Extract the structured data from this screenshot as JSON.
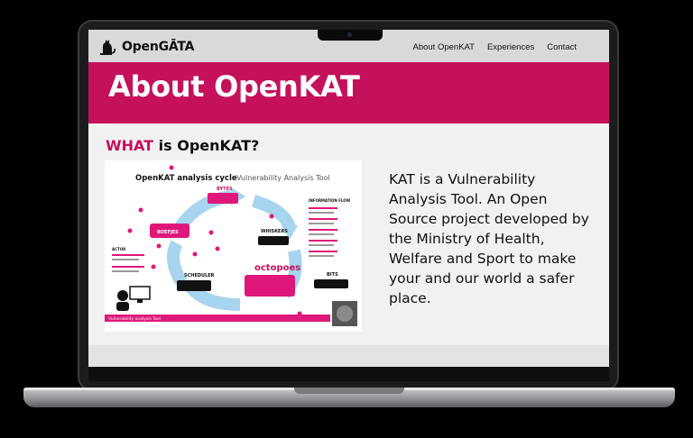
{
  "brand": {
    "name": "OpenGĀTA"
  },
  "nav": {
    "items": [
      "About OpenKAT",
      "Experiences",
      "Contact"
    ]
  },
  "hero": {
    "title": "About OpenKAT"
  },
  "section": {
    "title_accent": "WHAT",
    "title_rest": " is OpenKAT?"
  },
  "diagram": {
    "title_bold": "OpenKAT analysis cycle",
    "title_light": "Vulnerability Analysis Tool",
    "nodes": {
      "bytes": "BYTES",
      "boefjes": "BOEFJES",
      "whiskers": "WHISKERS",
      "octopoes": "octopoes",
      "scheduler": "SCHEDULER",
      "bits": "BITS"
    },
    "left_list_title": "ACTOR",
    "right_list_title": "INFORMATION FLOW",
    "footer": "Vulnerability analysis Tool"
  },
  "description": "KAT is a Vulnerability Analysis Tool. An Open Source project developed by the Ministry of Health, Welfare and Sport to make your and our world a safer place.",
  "colors": {
    "accent": "#c5105c",
    "diagram_blue": "#a7d4ee",
    "nav_bg": "#d9d9d9",
    "page_bg": "#f1f1f1"
  }
}
